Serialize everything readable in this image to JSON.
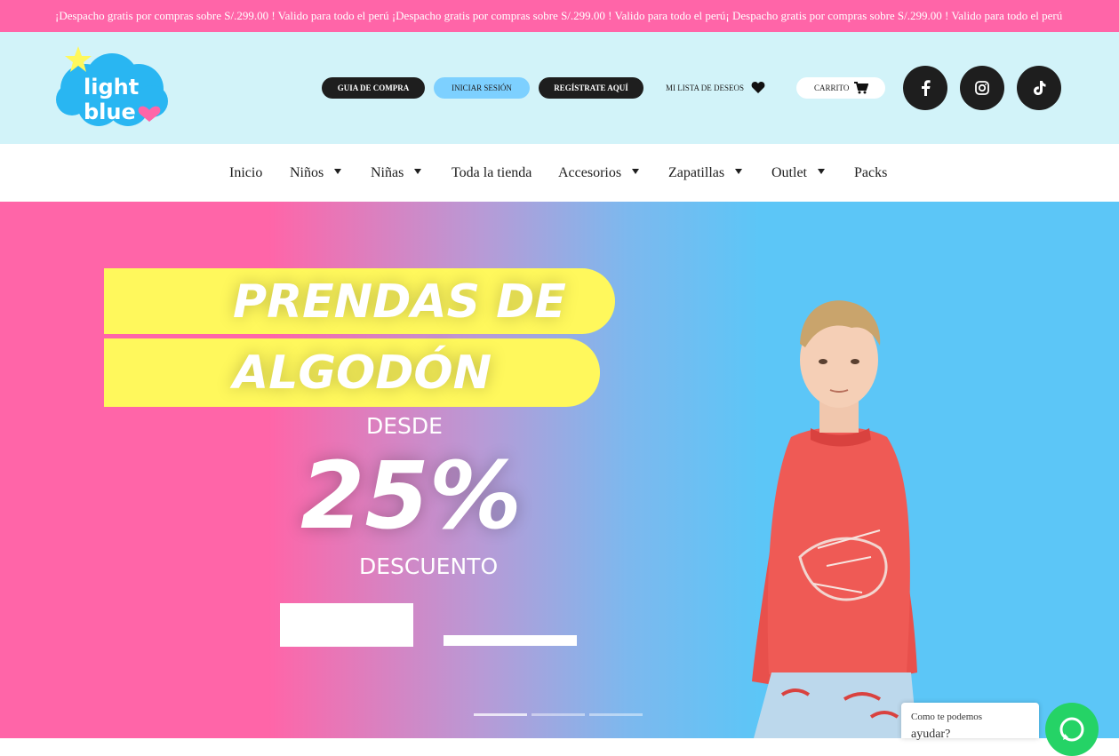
{
  "announcement": "¡Despacho gratis por compras sobre S/.299.00 ! Valido para todo el perú ¡Despacho gratis por compras sobre S/.299.00 ! Valido para todo el perú¡ Despacho gratis por compras sobre S/.299.00 ! Valido para todo el perú",
  "logo": {
    "line1": "light",
    "line2": "blue"
  },
  "header": {
    "guide_label": "GUIA DE COMPRA",
    "login_label": "INICIAR SESIÓN",
    "register_label": "REGÍSTRATE AQUÍ",
    "wishlist_label": "MI LISTA DE DESEOS",
    "cart_label": "CARRITO"
  },
  "social": [
    "facebook-icon",
    "instagram-icon",
    "tiktok-icon"
  ],
  "nav": {
    "items": [
      "Inicio",
      "Niños",
      "Niñas",
      "Toda la tienda",
      "Accesorios",
      "Zapatillas",
      "Outlet",
      "Packs"
    ]
  },
  "hero": {
    "line1": "PRENDAS DE",
    "line2": "ALGODÓN",
    "from": "DESDE",
    "percent": "25%",
    "discount": "DESCUENTO"
  },
  "slider": {
    "slides": 3,
    "active": 1
  },
  "chat": {
    "line1": "Como te podemos",
    "line2": "ayudar?"
  },
  "colors": {
    "announcement_bg": "#ff65a8",
    "header_bg": "#d2f3f9",
    "accent_blue": "#7dd0ff",
    "dark": "#1e1e1e",
    "hero_yellow": "#fff85c",
    "hero_pink": "#ff65a8",
    "hero_blue": "#5cc6f7",
    "whatsapp": "#25d366"
  }
}
